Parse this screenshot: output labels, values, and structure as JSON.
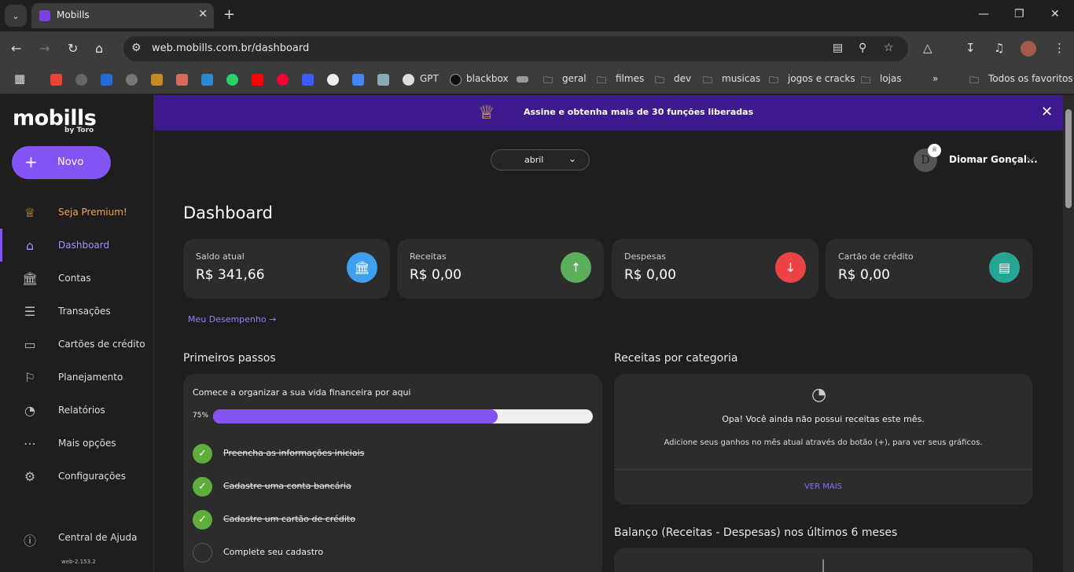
{
  "browser": {
    "tab_title": "Mobills",
    "url": "web.mobills.com.br/dashboard",
    "bookmarks": [
      "GPT",
      "blackbox",
      "geral",
      "filmes",
      "dev",
      "musicas",
      "jogos e cracks",
      "lojas",
      "Todos os favoritos"
    ]
  },
  "app": {
    "logo": "mobills",
    "logo_sub": "by Toro",
    "new_button": "Novo",
    "version": "web-2.153.2"
  },
  "sidebar": {
    "items": [
      {
        "label": "Seja Premium!",
        "icon": "crown-icon"
      },
      {
        "label": "Dashboard",
        "icon": "home-icon"
      },
      {
        "label": "Contas",
        "icon": "bank-icon"
      },
      {
        "label": "Transações",
        "icon": "list-icon"
      },
      {
        "label": "Cartões de crédito",
        "icon": "card-icon"
      },
      {
        "label": "Planejamento",
        "icon": "flag-icon"
      },
      {
        "label": "Relatórios",
        "icon": "pie-icon"
      },
      {
        "label": "Mais opções",
        "icon": "dots-icon"
      },
      {
        "label": "Configurações",
        "icon": "gear-icon"
      },
      {
        "label": "Central de Ajuda",
        "icon": "help-icon"
      }
    ]
  },
  "banner": {
    "text": "Assine e obtenha mais de 30 funções liberadas"
  },
  "header": {
    "month": "abril",
    "avatar_letter": "D",
    "user_name": "Diomar Gonçal..."
  },
  "dashboard": {
    "title": "Dashboard",
    "cards": [
      {
        "label": "Saldo atual",
        "value": "R$ 341,66",
        "icon": "bank-icon",
        "color": "#3ea0f0"
      },
      {
        "label": "Receitas",
        "value": "R$ 0,00",
        "icon": "arrow-up-icon",
        "color": "#5dae5c"
      },
      {
        "label": "Despesas",
        "value": "R$ 0,00",
        "icon": "arrow-down-icon",
        "color": "#ec4444"
      },
      {
        "label": "Cartão de crédito",
        "value": "R$ 0,00",
        "icon": "wallet-icon",
        "color": "#26a594"
      }
    ],
    "performance_link": "Meu Desempenho"
  },
  "first_steps": {
    "title": "Primeiros passos",
    "intro": "Comece a organizar a sua vida financeira por aqui",
    "progress_label": "75%",
    "progress": 0.75,
    "steps": [
      {
        "text": "Preencha as informações iniciais",
        "done": true
      },
      {
        "text": "Cadastre uma conta bancária",
        "done": true
      },
      {
        "text": "Cadastre um cartão de crédito",
        "done": true
      },
      {
        "text": "Complete seu cadastro",
        "done": false
      }
    ]
  },
  "income_by_category": {
    "title": "Receitas por categoria",
    "empty_title": "Opa! Você ainda não possui receitas este mês.",
    "empty_text": "Adicione seus ganhos no mês atual através do botão (+), para ver seus gráficos.",
    "more": "VER MAIS"
  },
  "balance": {
    "title": "Balanço (Receitas - Despesas) nos últimos 6 meses"
  }
}
